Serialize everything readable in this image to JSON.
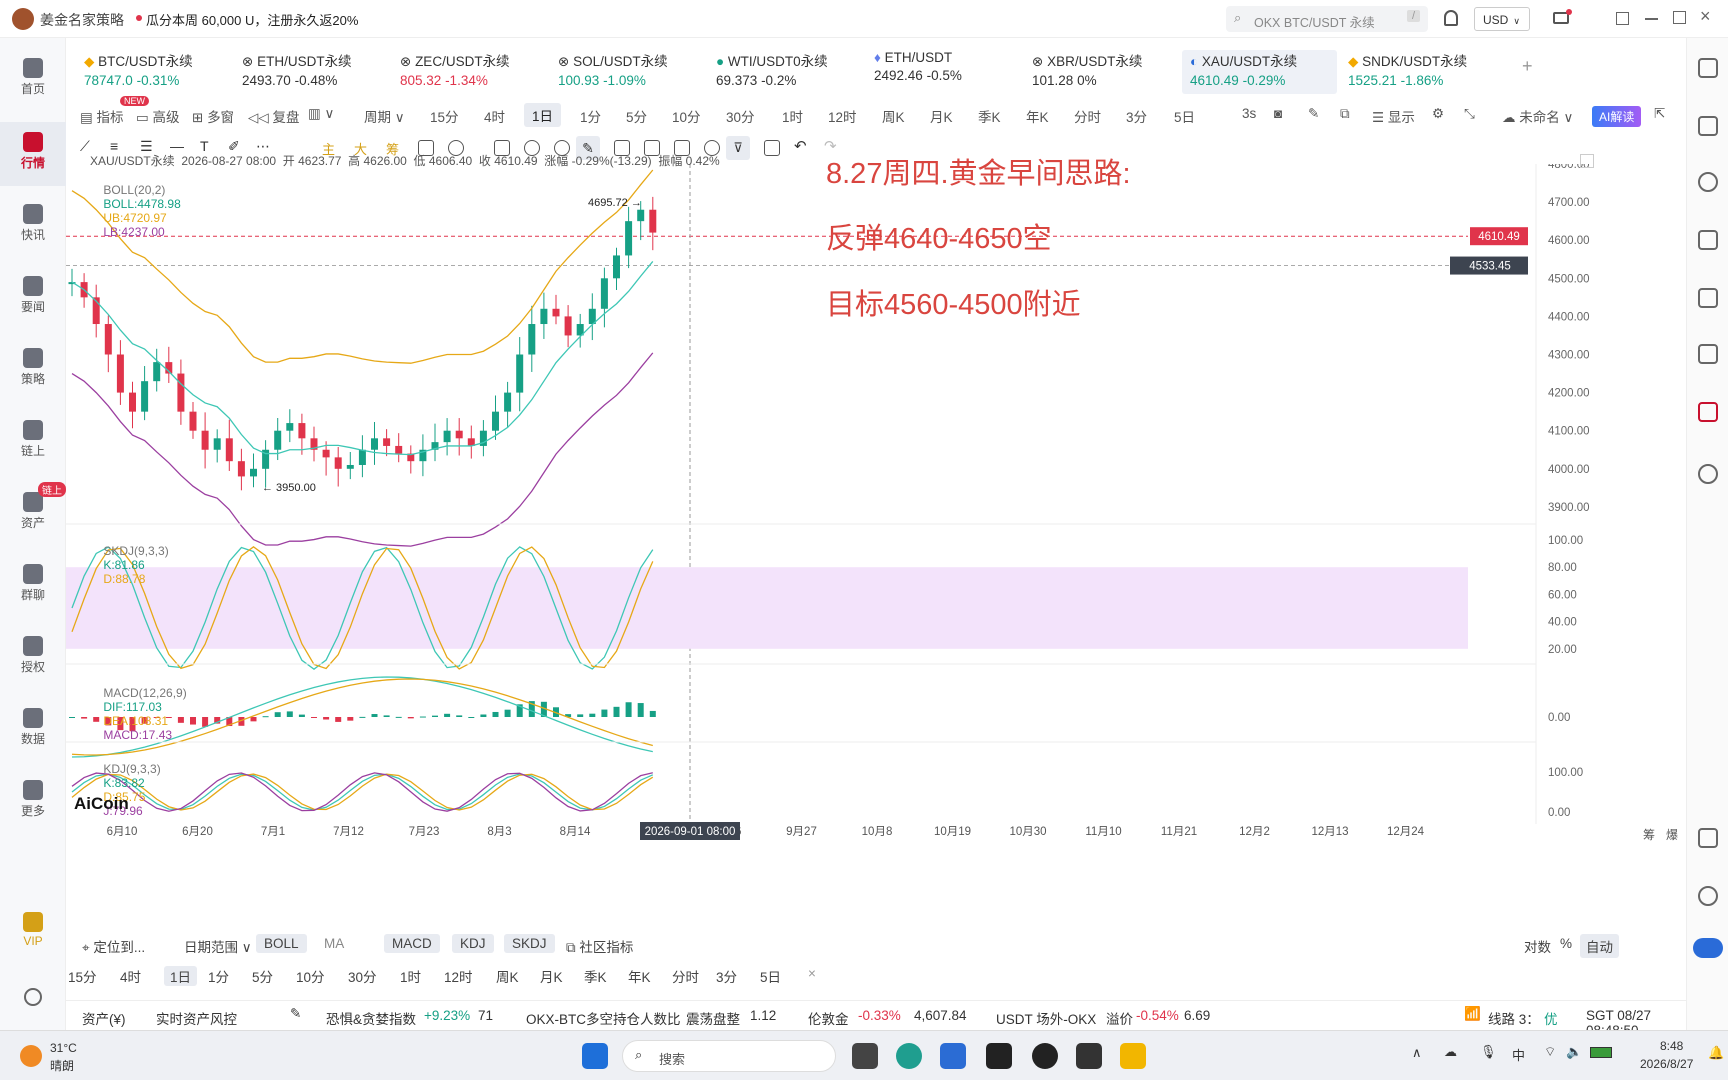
{
  "window": {
    "app_name": "姜金名家策略",
    "promo": "瓜分本周 60,000 U，注册永久返20%",
    "search_placeholder": "OKX BTC/USDT 永续",
    "search_shortcut": "/",
    "currency": "USD"
  },
  "nav": [
    {
      "label": "首页"
    },
    {
      "label": "行情"
    },
    {
      "label": "快讯"
    },
    {
      "label": "要闻"
    },
    {
      "label": "策略"
    },
    {
      "label": "链上"
    },
    {
      "label": "资产",
      "badge": "链上"
    },
    {
      "label": "群聊"
    },
    {
      "label": "授权"
    },
    {
      "label": "数据"
    },
    {
      "label": "更多"
    },
    {
      "label": "VIP"
    }
  ],
  "tickers": [
    {
      "name": "BTC/USDT永续",
      "price": "78747.0",
      "change": "-0.31%"
    },
    {
      "name": "ETH/USDT永续",
      "price": "2493.70",
      "change": "-0.48%"
    },
    {
      "name": "ZEC/USDT永续",
      "price": "805.32",
      "change": "-1.34%"
    },
    {
      "name": "SOL/USDT永续",
      "price": "100.93",
      "change": "-1.09%"
    },
    {
      "name": "WTI/USDT0永续",
      "price": "69.373",
      "change": "-0.2%"
    },
    {
      "name": "ETH/USDT",
      "price": "2492.46",
      "change": "-0.5%"
    },
    {
      "name": "XBR/USDT永续",
      "price": "101.28",
      "change": "0%"
    },
    {
      "name": "XAU/USDT永续",
      "price": "4610.49",
      "change": "-0.29%"
    },
    {
      "name": "SNDK/USDT永续",
      "price": "1525.21",
      "change": "-1.86%"
    }
  ],
  "toolbar": {
    "indicator": "指标",
    "new_badge": "NEW",
    "advanced": "高级",
    "multi": "多窗",
    "replay": "复盘",
    "period": "周期",
    "selected_tf": "1日",
    "timeframes": [
      "15分",
      "4时",
      "1日",
      "1分",
      "5分",
      "10分",
      "30分",
      "1时",
      "12时",
      "周K",
      "月K",
      "季K",
      "年K",
      "分时",
      "3分",
      "5日"
    ],
    "refresh": "3s",
    "display": "显示",
    "unnamed": "未命名",
    "ai": "AI解读",
    "draw_labels": [
      "主",
      "大",
      "筹"
    ]
  },
  "chart": {
    "symbol_line": "XAU/USDT永续  2026-08-27 08:00  开 4623.77  高 4626.00  低 4606.40  收 4610.49  涨幅 -0.29%(-13.29)  振幅 0.42%",
    "boll_name": "BOLL(20,2)",
    "boll_vals": "BOLL:4478.98",
    "boll_ub": "UB:4720.97",
    "boll_lb": "LB:4237.00",
    "high_marker": "4695.72 →",
    "low_marker": "← 3950.00",
    "annotation": [
      "8.27周四.黄金早间思路:",
      "反弹4640-4650空",
      "目标4560-4500附近"
    ],
    "price_axis": [
      "4800.00",
      "4700.00",
      "4600.00",
      "4500.00",
      "4400.00",
      "4300.00",
      "4200.00",
      "4100.00",
      "4000.00",
      "3900.00"
    ],
    "last_price": "4610.49",
    "cursor_price": "4533.45",
    "skdj": {
      "name": "SKDJ(9,3,3)",
      "k": "K:81.86",
      "d": "D:88.78",
      "axis": [
        "100.00",
        "80.00",
        "60.00",
        "40.00",
        "20.00"
      ]
    },
    "macd": {
      "name": "MACD(12,26,9)",
      "dif": "DIF:117.03",
      "dea": "DEA:108.31",
      "macd": "MACD:17.43",
      "axis": [
        "0.00"
      ]
    },
    "kdj": {
      "name": "KDJ(9,3,3)",
      "k": "K:83.82",
      "d": "D:85.75",
      "j": "J:79.96",
      "axis": [
        "100.00",
        "0.00"
      ]
    },
    "x_axis": [
      "6月10",
      "6月20",
      "7月1",
      "7月12",
      "7月23",
      "8月3",
      "8月14",
      "8月",
      "9月16",
      "9月27",
      "10月8",
      "10月19",
      "10月30",
      "11月10",
      "11月21",
      "12月2",
      "12月13",
      "12月24"
    ],
    "cursor_time": "2026-09-01 08:00",
    "logo": "AiCoin",
    "scale_labels": [
      "筹",
      "爆"
    ]
  },
  "bottom": {
    "locate": "定位到...",
    "date_range": "日期范围",
    "tabs": [
      "BOLL",
      "MA",
      "MACD",
      "KDJ",
      "SKDJ"
    ],
    "community": "社区指标",
    "right": [
      "对数",
      "%",
      "自动"
    ],
    "timeframes": [
      "15分",
      "4时",
      "1日",
      "1分",
      "5分",
      "10分",
      "30分",
      "1时",
      "12时",
      "周K",
      "月K",
      "季K",
      "年K",
      "分时",
      "3分",
      "5日"
    ],
    "close": "×"
  },
  "status": {
    "asset": "资产(¥)",
    "risk": "实时资产风控",
    "fear": "恐惧&贪婪指数",
    "fear_change": "+9.23%",
    "fear_val": "71",
    "ratio": "OKX-BTC多空持仓人数比",
    "ratio_state": "震荡盘整",
    "ratio_val": "1.12",
    "gold": "伦敦金",
    "gold_change": "-0.33%",
    "gold_val": "4,607.84",
    "usdt": "USDT 场外-OKX",
    "premium": "溢价",
    "premium_val": "-0.54%",
    "premium_num": "6.69",
    "line": "线路 3：",
    "line_q": "优",
    "clock": "SGT 08/27 08:48:50"
  },
  "taskbar": {
    "temp": "31°C",
    "weather": "晴朗",
    "search": "搜索",
    "lang": "中",
    "time": "8:48",
    "date": "2026/8/27"
  }
}
